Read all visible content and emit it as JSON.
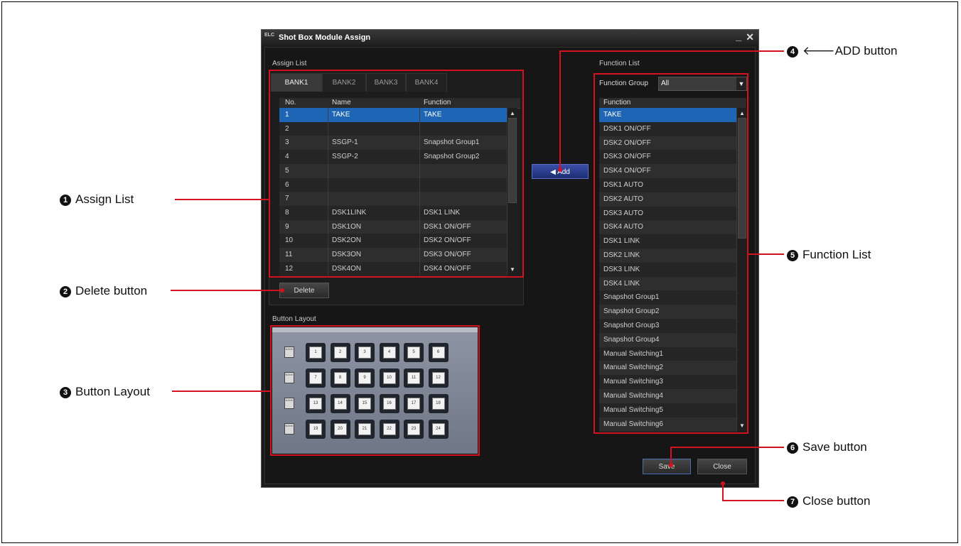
{
  "window": {
    "title": "Shot Box Module Assign",
    "minimize": "_",
    "close": "✕",
    "icon_text": "ELC"
  },
  "assign_list": {
    "label": "Assign List",
    "tabs": [
      "BANK1",
      "BANK2",
      "BANK3",
      "BANK4"
    ],
    "active_tab": "BANK1",
    "headers": [
      "No.",
      "Name",
      "Function"
    ],
    "rows": [
      {
        "no": "1",
        "name": "TAKE",
        "function": "TAKE"
      },
      {
        "no": "2",
        "name": "",
        "function": ""
      },
      {
        "no": "3",
        "name": "SSGP-1",
        "function": "Snapshot Group1"
      },
      {
        "no": "4",
        "name": "SSGP-2",
        "function": "Snapshot Group2"
      },
      {
        "no": "5",
        "name": "",
        "function": ""
      },
      {
        "no": "6",
        "name": "",
        "function": ""
      },
      {
        "no": "7",
        "name": "",
        "function": ""
      },
      {
        "no": "8",
        "name": "DSK1LINK",
        "function": "DSK1 LINK"
      },
      {
        "no": "9",
        "name": "DSK1ON",
        "function": "DSK1 ON/OFF"
      },
      {
        "no": "10",
        "name": "DSK2ON",
        "function": "DSK2 ON/OFF"
      },
      {
        "no": "11",
        "name": "DSK3ON",
        "function": "DSK3 ON/OFF"
      },
      {
        "no": "12",
        "name": "DSK4ON",
        "function": "DSK4 ON/OFF"
      }
    ],
    "delete_label": "Delete"
  },
  "add_button_label": "Add",
  "function_list": {
    "label": "Function List",
    "group_label": "Function Group",
    "group_value": "All",
    "header": "Function",
    "items": [
      "TAKE",
      "DSK1 ON/OFF",
      "DSK2 ON/OFF",
      "DSK3 ON/OFF",
      "DSK4 ON/OFF",
      "DSK1 AUTO",
      "DSK2 AUTO",
      "DSK3 AUTO",
      "DSK4 AUTO",
      "DSK1 LINK",
      "DSK2 LINK",
      "DSK3 LINK",
      "DSK4 LINK",
      "Snapshot Group1",
      "Snapshot Group2",
      "Snapshot Group3",
      "Snapshot Group4",
      "Manual Switching1",
      "Manual Switching2",
      "Manual Switching3",
      "Manual Switching4",
      "Manual Switching5",
      "Manual Switching6"
    ]
  },
  "button_layout": {
    "label": "Button Layout",
    "bank_button_text": "BANK",
    "keys": [
      "1",
      "2",
      "3",
      "4",
      "5",
      "6",
      "7",
      "8",
      "9",
      "10",
      "11",
      "12",
      "13",
      "14",
      "15",
      "16",
      "17",
      "18",
      "19",
      "20",
      "21",
      "22",
      "23",
      "24"
    ]
  },
  "footer": {
    "save_label": "Save",
    "close_label": "Close"
  },
  "callouts": [
    {
      "number": "1",
      "text": "Assign List"
    },
    {
      "number": "2",
      "text": "Delete button"
    },
    {
      "number": "3",
      "text": "Button Layout"
    },
    {
      "number": "4",
      "text": "ADD button",
      "arrow": "🡐"
    },
    {
      "number": "5",
      "text": "Function List"
    },
    {
      "number": "6",
      "text": "Save button"
    },
    {
      "number": "7",
      "text": "Close button"
    }
  ],
  "colors": {
    "highlight_red": "#d4111f",
    "selection_blue": "#1e66b5",
    "add_blue": "#2a3c8f"
  }
}
